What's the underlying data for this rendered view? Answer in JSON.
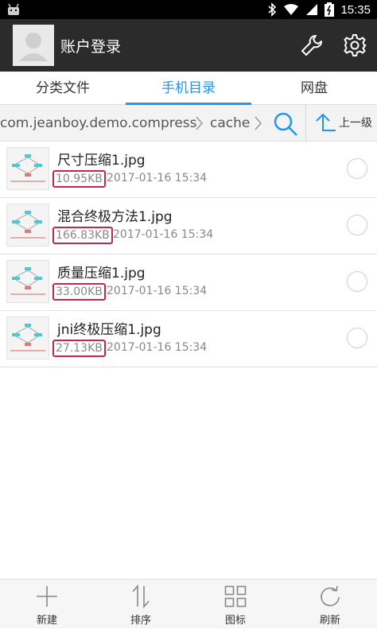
{
  "status_bar": {
    "time": "15:35",
    "icons": [
      "android-debug-icon",
      "bluetooth-icon",
      "wifi-icon",
      "signal-icon",
      "battery-charging-icon"
    ]
  },
  "header": {
    "title": "账户登录",
    "avatar_icon": "user-avatar-icon",
    "actions": [
      "wrench-icon",
      "gear-icon"
    ]
  },
  "tabs": [
    {
      "label": "分类文件",
      "active": false
    },
    {
      "label": "手机目录",
      "active": true
    },
    {
      "label": "网盘",
      "active": false
    }
  ],
  "path": {
    "crumbs": [
      "com.jeanboy.demo.compress",
      "cache"
    ],
    "up_label": "上一级"
  },
  "files": [
    {
      "name": "尺寸压缩1.jpg",
      "size": "10.95KB",
      "date": "2017-01-16 15:34"
    },
    {
      "name": "混合终极方法1.jpg",
      "size": "166.83KB",
      "date": "2017-01-16 15:34"
    },
    {
      "name": "质量压缩1.jpg",
      "size": "33.00KB",
      "date": "2017-01-16 15:34"
    },
    {
      "name": "jni终极压缩1.jpg",
      "size": "27.13KB",
      "date": "2017-01-16 15:34"
    }
  ],
  "bottom_bar": [
    {
      "label": "新建",
      "icon": "plus-icon"
    },
    {
      "label": "排序",
      "icon": "sort-icon"
    },
    {
      "label": "图标",
      "icon": "grid-icon"
    },
    {
      "label": "刷新",
      "icon": "refresh-icon"
    }
  ],
  "colors": {
    "accent": "#2196f3",
    "appbar": "#2b2b2b",
    "highlight_box": "#c7254e"
  }
}
